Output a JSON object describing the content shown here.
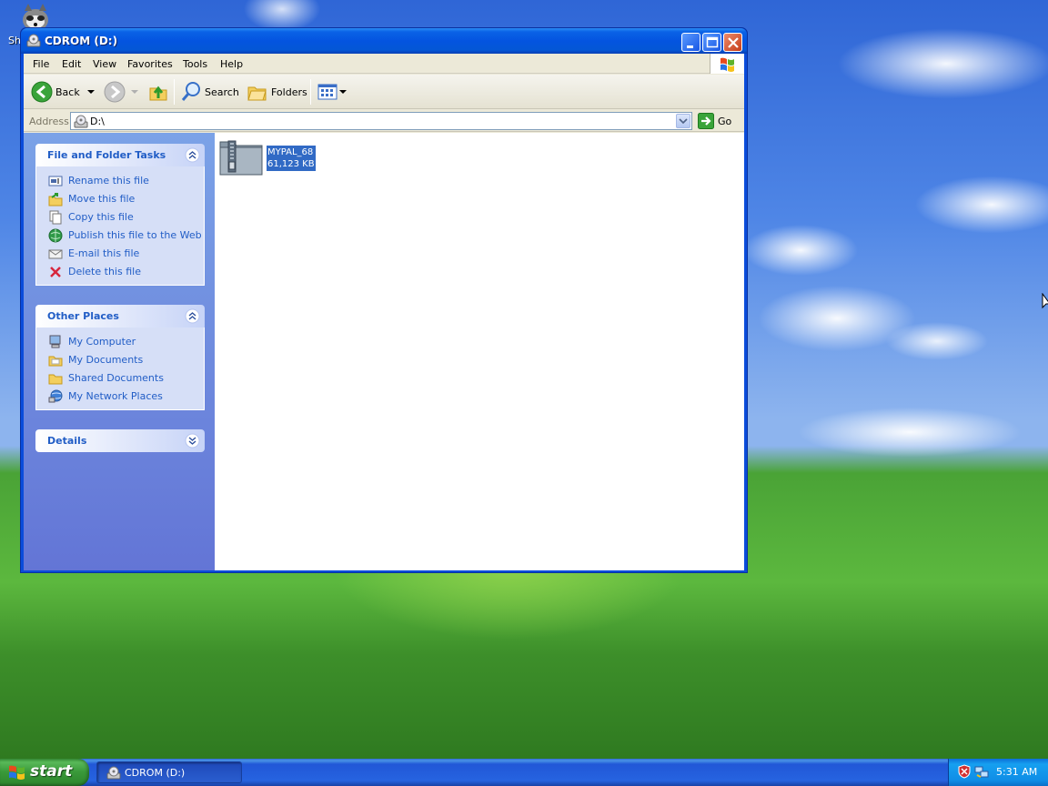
{
  "desktop": {
    "icon_label": "Sh"
  },
  "window": {
    "title": "CDROM (D:)"
  },
  "menu": {
    "file": "File",
    "edit": "Edit",
    "view": "View",
    "favorites": "Favorites",
    "tools": "Tools",
    "help": "Help"
  },
  "toolbar": {
    "back": "Back",
    "search": "Search",
    "folders": "Folders"
  },
  "address": {
    "label": "Address",
    "value": "D:\\",
    "go": "Go"
  },
  "panels": {
    "file_tasks": {
      "title": "File and Folder Tasks",
      "items": [
        {
          "label": "Rename this file",
          "icon": "rename-icon"
        },
        {
          "label": "Move this file",
          "icon": "move-icon"
        },
        {
          "label": "Copy this file",
          "icon": "copy-icon"
        },
        {
          "label": "Publish this file to the Web",
          "icon": "publish-web-icon"
        },
        {
          "label": "E-mail this file",
          "icon": "email-icon"
        },
        {
          "label": "Delete this file",
          "icon": "delete-icon"
        }
      ]
    },
    "other_places": {
      "title": "Other Places",
      "items": [
        {
          "label": "My Computer",
          "icon": "my-computer-icon"
        },
        {
          "label": "My Documents",
          "icon": "folder-icon"
        },
        {
          "label": "Shared Documents",
          "icon": "folder-icon"
        },
        {
          "label": "My Network Places",
          "icon": "network-icon"
        }
      ]
    },
    "details": {
      "title": "Details"
    }
  },
  "files": [
    {
      "name": "MYPAL_68",
      "size": "61,123 KB",
      "icon": "zip-archive-icon",
      "selected": true
    }
  ],
  "taskbar": {
    "start": "start",
    "window_button": "CDROM (D:)",
    "clock": "5:31 AM"
  },
  "colors": {
    "selection": "#316ac5",
    "task_link": "#215dc6",
    "title_bar": "#0454e0"
  }
}
